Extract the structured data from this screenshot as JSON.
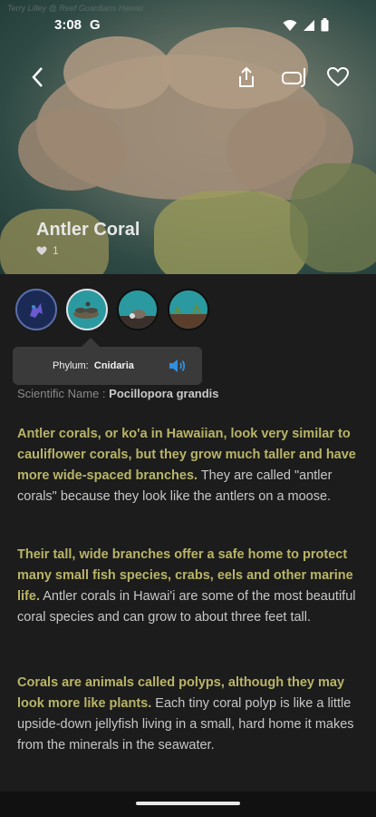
{
  "hero": {
    "credit": "Terry Lilley @ Reef Guardians Hawaii",
    "title": "Antler Coral",
    "likes": "1"
  },
  "status_bar": {
    "time": "3:08",
    "app_glyph": "G"
  },
  "tooltip": {
    "phylum_label": "Phylum:",
    "phylum_value": "Cnidaria"
  },
  "scientific": {
    "label": "Scientific Name :",
    "value": "Pocillopora grandis"
  },
  "paragraphs": [
    {
      "highlight": "Antler corals, or ko'a in Hawaiian, look very similar to cauliflower corals, but they grow much taller and have more wide-spaced branches.",
      "text": " They are called \"antler corals\" because they look like the antlers on a moose."
    },
    {
      "highlight": "Their tall, wide branches offer a safe home to protect many small fish species, crabs, eels and other marine life.",
      "text": " Antler corals in Hawai'i are some of the most beautiful coral species and can grow to about three feet tall."
    },
    {
      "highlight": "Corals are animals called polyps, although they may look more like plants.",
      "text": " Each tiny coral polyp is like a little upside-down jellyfish living in a small, hard home it makes from the minerals in the seawater."
    }
  ],
  "chips": [
    {
      "name": "reef-animal-chip",
      "color": "#1b2a55"
    },
    {
      "name": "phylum-chip",
      "color": "#2b9aa0"
    },
    {
      "name": "habitat-chip",
      "color": "#2b9aa0"
    },
    {
      "name": "location-chip",
      "color": "#2b9aa0"
    }
  ],
  "colors": {
    "highlight": "#b9b567",
    "background": "#1c1c1c",
    "tooltip": "#3a3a3a"
  }
}
